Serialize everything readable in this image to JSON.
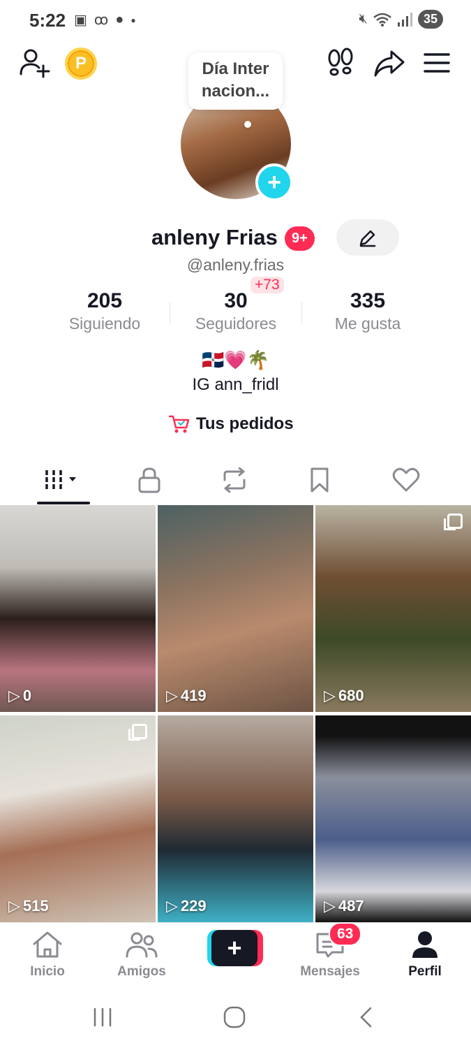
{
  "status_bar": {
    "time": "5:22",
    "left_icons": [
      "screenshot-icon",
      "voicemail-icon",
      "chat-icon",
      "dot-icon"
    ],
    "battery": "35"
  },
  "top_bar": {
    "coin_label": "P"
  },
  "note_bubble": {
    "line1": "Día Inter",
    "line2": "nacion..."
  },
  "profile": {
    "display_name": "anleny Frias",
    "name_badge": "9+",
    "username": "@anleny.frias",
    "followers_delta": "+73",
    "stats": [
      {
        "value": "205",
        "label": "Siguiendo"
      },
      {
        "value": "30",
        "label": "Seguidores"
      },
      {
        "value": "335",
        "label": "Me gusta"
      }
    ],
    "bio_emoji": "🇩🇴💗🌴",
    "bio_text": "IG ann_fridl",
    "orders_label": "Tus pedidos"
  },
  "tabs": [
    "videos-grid-icon",
    "lock-icon",
    "repost-icon",
    "bookmark-icon",
    "heart-icon"
  ],
  "videos": [
    {
      "views": "0",
      "multi": false
    },
    {
      "views": "419",
      "multi": false
    },
    {
      "views": "680",
      "multi": true
    },
    {
      "views": "515",
      "multi": true
    },
    {
      "views": "229",
      "multi": false
    },
    {
      "views": "487",
      "multi": false
    }
  ],
  "bottom_nav": {
    "home": "Inicio",
    "friends": "Amigos",
    "create": "+",
    "messages": "Mensajes",
    "messages_badge": "63",
    "profile": "Perfil"
  },
  "colors": {
    "accent_red": "#fe2c55",
    "accent_cyan": "#20d5ec",
    "text_dark": "#161823",
    "text_grey": "#8a8b91"
  }
}
